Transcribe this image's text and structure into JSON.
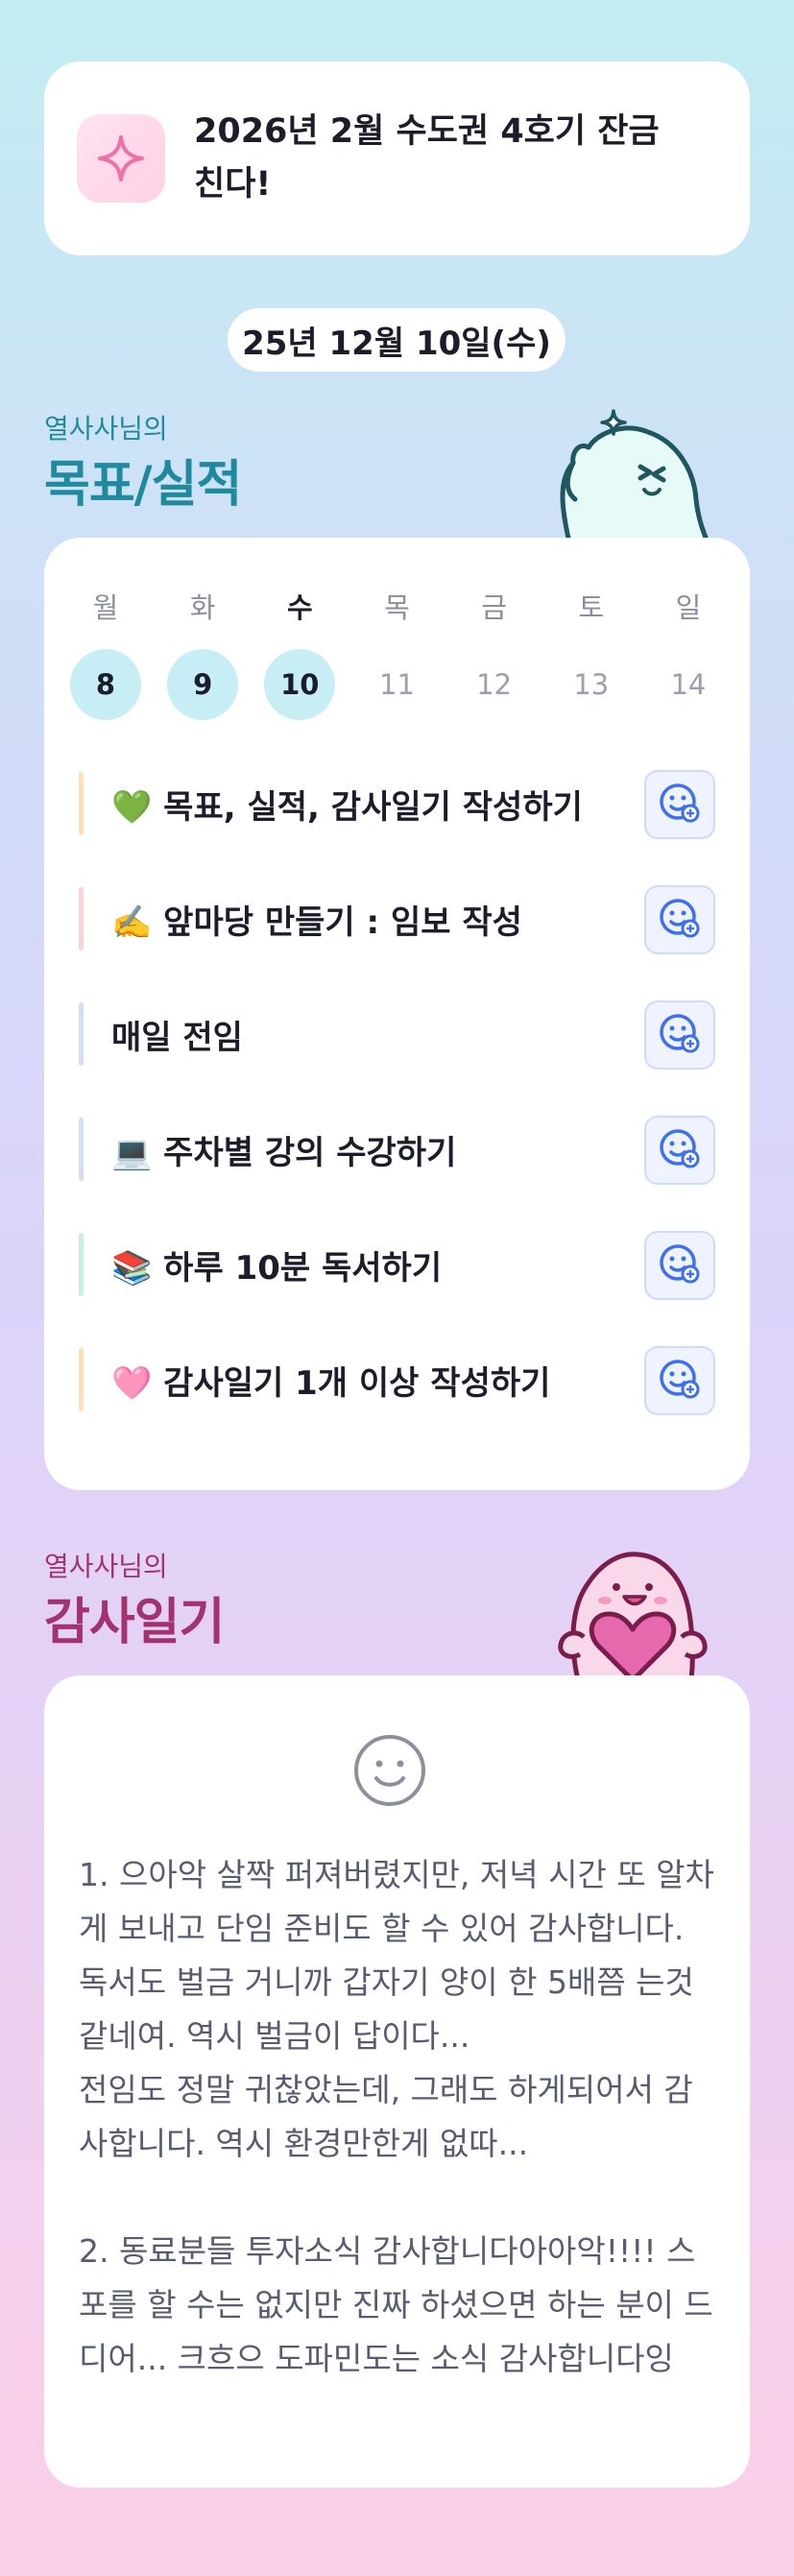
{
  "goal": {
    "text": "2026년 2월 수도권 4호기 잔금 친다!",
    "icon": "sparkle-icon",
    "icon_color": "#f06fa6"
  },
  "date_label": "25년 12월 10일(수)",
  "goals_section": {
    "subtitle": "열사사님의",
    "title": "목표/실적",
    "color": "#1f8a9e"
  },
  "calendar": {
    "days": [
      {
        "dow": "월",
        "num": "8",
        "active": true,
        "today": false
      },
      {
        "dow": "화",
        "num": "9",
        "active": true,
        "today": false
      },
      {
        "dow": "수",
        "num": "10",
        "active": true,
        "today": true
      },
      {
        "dow": "목",
        "num": "11",
        "active": false,
        "today": false
      },
      {
        "dow": "금",
        "num": "12",
        "active": false,
        "today": false
      },
      {
        "dow": "토",
        "num": "13",
        "active": false,
        "today": false
      },
      {
        "dow": "일",
        "num": "14",
        "active": false,
        "today": false
      }
    ]
  },
  "tasks": [
    {
      "text": "💚 목표, 실적, 감사일기 작성하기",
      "color": "#fde0b8"
    },
    {
      "text": "✍️ 앞마당 만들기 : 임보 작성",
      "color": "#fbd3d3"
    },
    {
      "text": "매일 전임",
      "color": "#d6def5"
    },
    {
      "text": "💻 주차별 강의 수강하기",
      "color": "#d6def5"
    },
    {
      "text": "📚 하루 10분 독서하기",
      "color": "#c9efde"
    },
    {
      "text": "🩷 감사일기 1개 이상 작성하기",
      "color": "#fde0b8"
    }
  ],
  "journal_section": {
    "subtitle": "열사사님의",
    "title": "감사일기",
    "color": "#a3326e"
  },
  "journal": {
    "icon": "smiley-icon",
    "text": "1. 으아악 살짝 퍼져버렸지만, 저녁 시간 또 알차게 보내고 단임 준비도 할 수 있어 감사합니다. 독서도 벌금 거니까 갑자기 양이 한 5배쯤 는것 같네여. 역시 벌금이 답이다...\n전임도 정말 귀찮았는데, 그래도 하게되어서 감사합니다. 역시 환경만한게 없따...\n\n2. 동료분들 투자소식 감사합니다아아악!!!! 스포를 할 수는 없지만 진짜 하셨으면 하는 분이 드디어... 크흐으 도파민도는 소식 감사합니다잉"
  }
}
